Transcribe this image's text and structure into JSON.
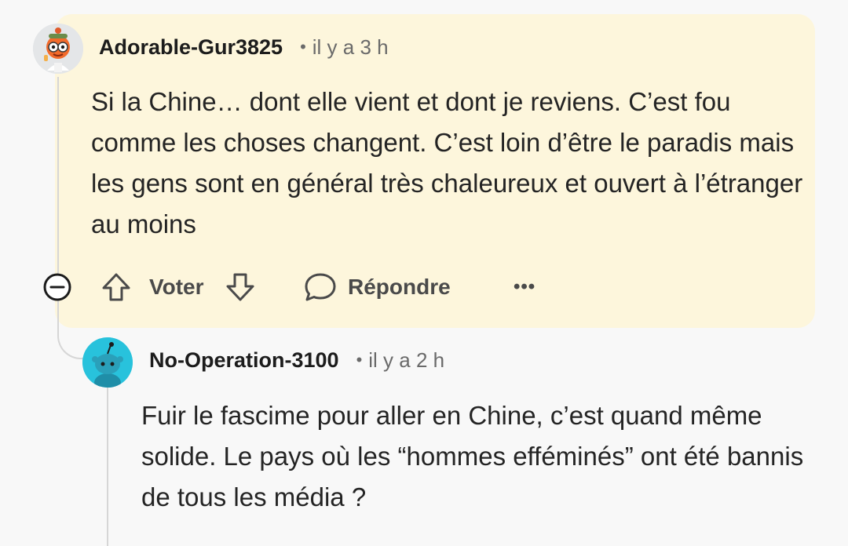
{
  "comments": [
    {
      "author": "Adorable-Gur3825",
      "separator": "•",
      "time": "il y a 3 h",
      "text": "Si la Chine… dont elle vient et dont je reviens. C’est fou comme les choses changent. C’est loin d’être le paradis mais les gens sont en général très chaleureux et ouvert à l’étranger au moins",
      "actions": {
        "vote_label": "Voter",
        "reply_label": "Répondre",
        "more_label": "•••"
      },
      "highlight_color": "#fdf6dc"
    },
    {
      "author": "No-Operation-3100",
      "separator": "•",
      "time": "il y a 2 h",
      "text": "Fuir le fascime pour aller en Chine, c’est quand même solide. Le pays où les “hommes efféminés” ont été bannis de tous les média ?",
      "avatar_color": "#28c2dc"
    }
  ],
  "icons": {
    "collapse": "minus-circle-icon",
    "upvote": "arrow-up-icon",
    "downvote": "arrow-down-icon",
    "reply": "chat-bubble-icon",
    "more": "more-dots-icon"
  }
}
